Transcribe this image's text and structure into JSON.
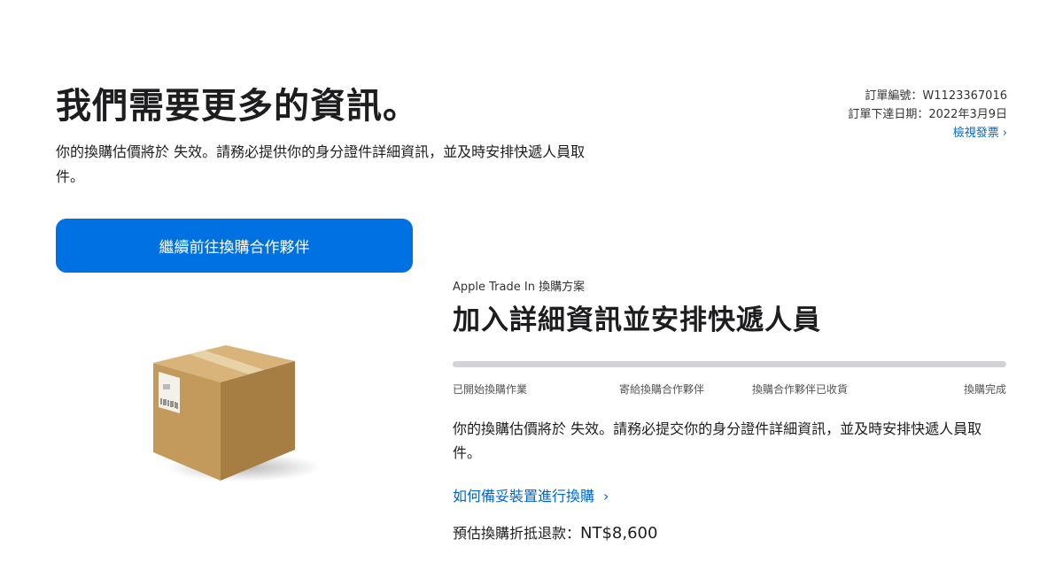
{
  "page": {
    "title": "我們需要更多的資訊。",
    "intro": "你的換購估價將於 失效。請務必提供你的身分證件詳細資訊，並及時安排快遞人員取件。"
  },
  "order": {
    "number_label": "訂單編號：W1123367016",
    "date_label": "訂單下達日期：2022年3月9日",
    "invoice_link": "檢視發票",
    "chevron": "›"
  },
  "cta": {
    "label": "繼續前往換購合作夥伴"
  },
  "trade_in": {
    "eyebrow": "Apple Trade In 換購方案",
    "title": "加入詳細資訊並安排快遞人員",
    "progress": 0,
    "steps": [
      "已開始換購作業",
      "寄給換購合作夥伴",
      "換購合作夥伴已收貨",
      "換購完成"
    ],
    "body": "你的換購估價將於 失效。請務必提交你的身分證件詳細資訊，並及時安排快遞人員取件。",
    "help_link": "如何備妥裝置進行換購",
    "help_chevron": "›",
    "estimate_label": "預估換購折抵退款：",
    "estimate_value": "NT$8,600"
  },
  "colors": {
    "accent": "#0071e3",
    "link": "#0066cc",
    "progress_track": "#d2d2d7"
  },
  "icons": {
    "box": "shipping-box-icon"
  }
}
